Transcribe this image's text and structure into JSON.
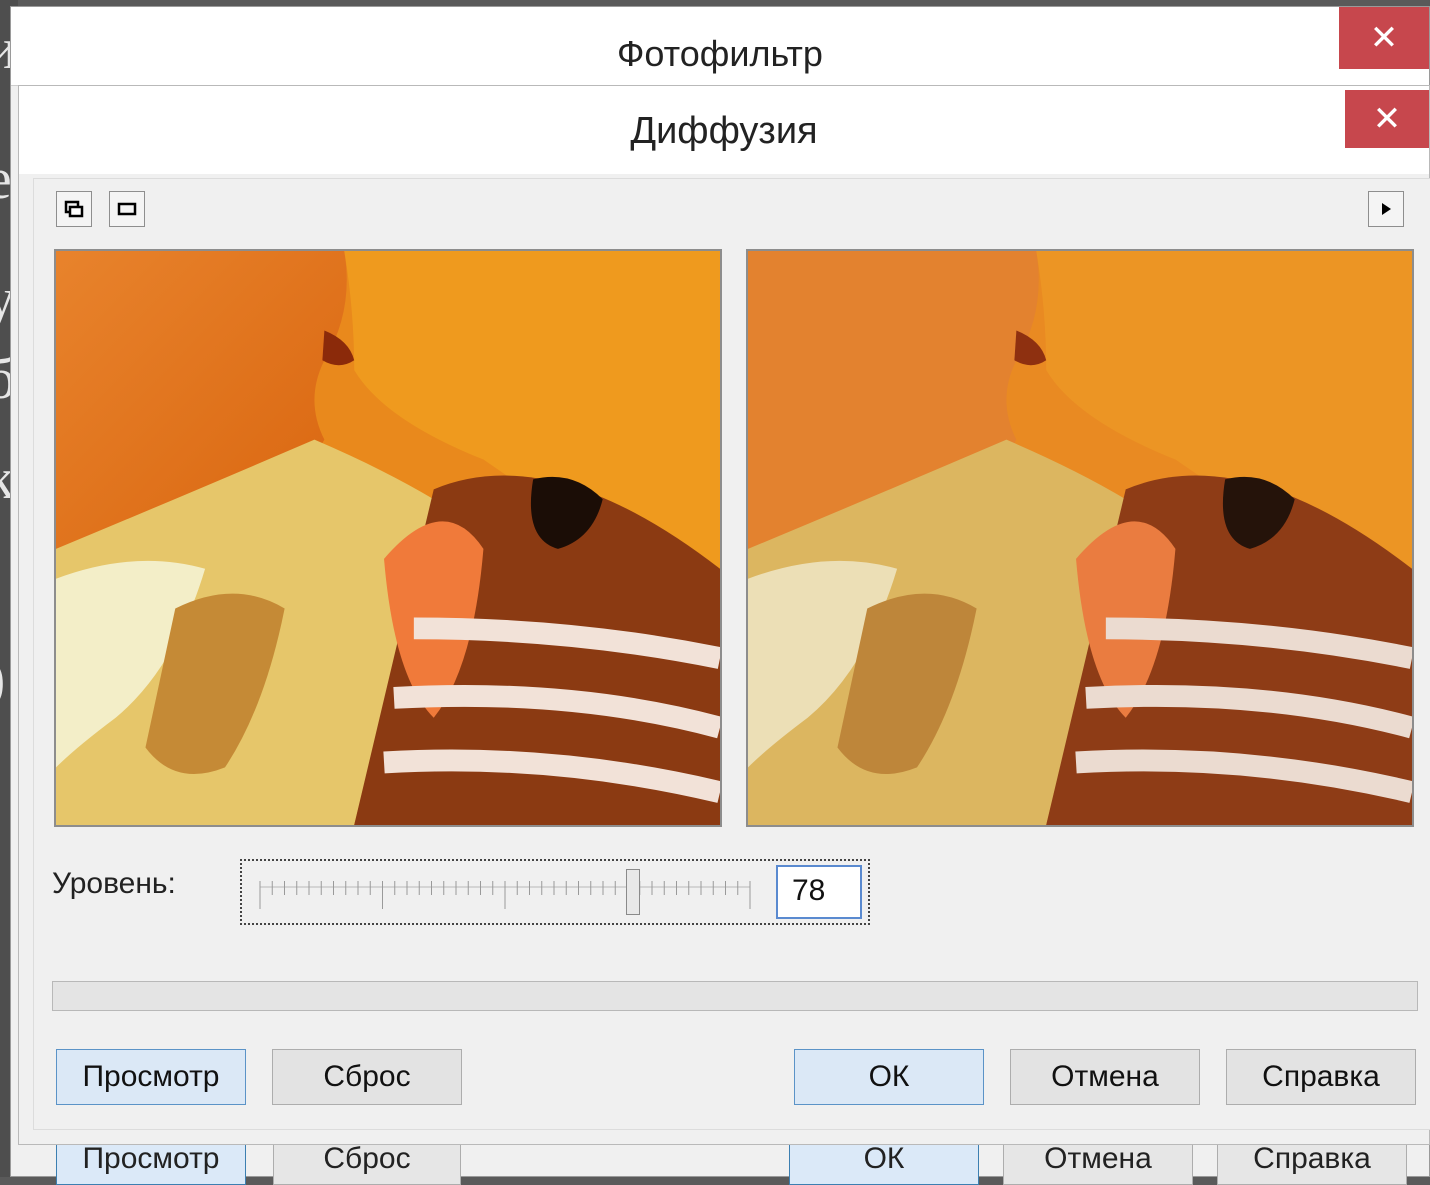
{
  "back_window": {
    "title": "Фотофильтр",
    "close": "✕",
    "buttons": {
      "preview": "Просмотр",
      "reset": "Сброс",
      "ok": "ОК",
      "cancel": "Отмена",
      "help": "Справка"
    }
  },
  "dialog": {
    "title": "Диффузия",
    "close": "✕",
    "toolbar": {
      "split_view_icon": "split-view-icon",
      "single_view_icon": "single-view-icon",
      "menu_arrow_icon": "play-arrow-icon"
    },
    "previews": {
      "original": "original-preview",
      "result": "result-preview"
    },
    "level": {
      "label": "Уровень:",
      "value": "78",
      "slider_value": 0.76
    },
    "progress": 0,
    "buttons": {
      "preview": "Просмотр",
      "reset": "Сброс",
      "ok": "ОК",
      "cancel": "Отмена",
      "help": "Справка"
    }
  },
  "colors": {
    "close_red": "#c7474d",
    "accent_blue": "#5b93c7"
  }
}
